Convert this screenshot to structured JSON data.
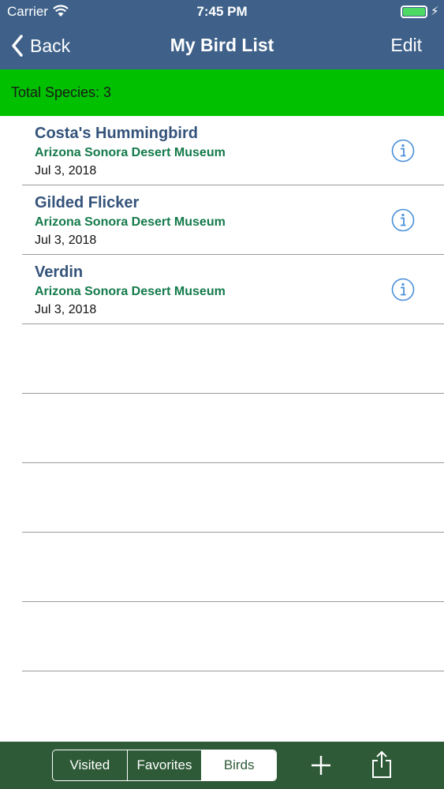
{
  "status_bar": {
    "carrier": "Carrier",
    "time": "7:45 PM"
  },
  "nav": {
    "back_label": "Back",
    "title": "My Bird List",
    "edit_label": "Edit"
  },
  "summary": {
    "text": "Total Species: 3"
  },
  "birds": [
    {
      "name": "Costa's Hummingbird",
      "location": "Arizona Sonora Desert Museum",
      "date": "Jul 3, 2018"
    },
    {
      "name": "Gilded Flicker",
      "location": "Arizona Sonora Desert Museum",
      "date": "Jul 3, 2018"
    },
    {
      "name": "Verdin",
      "location": "Arizona Sonora Desert Museum",
      "date": "Jul 3, 2018"
    }
  ],
  "toolbar": {
    "segments": [
      "Visited",
      "Favorites",
      "Birds"
    ],
    "selected_segment": "Birds"
  },
  "icons": {
    "wifi": "wifi-icon",
    "battery": "battery-icon",
    "back": "chevron-left-icon",
    "info": "info-icon",
    "add": "plus-icon",
    "share": "share-icon"
  },
  "colors": {
    "nav_bar": "#3f6189",
    "summary_bar": "#00c000",
    "toolbar": "#2e5a37",
    "bird_name": "#34537a",
    "location": "#137a4a",
    "info_icon": "#4a90d9",
    "battery": "#4cd964"
  }
}
